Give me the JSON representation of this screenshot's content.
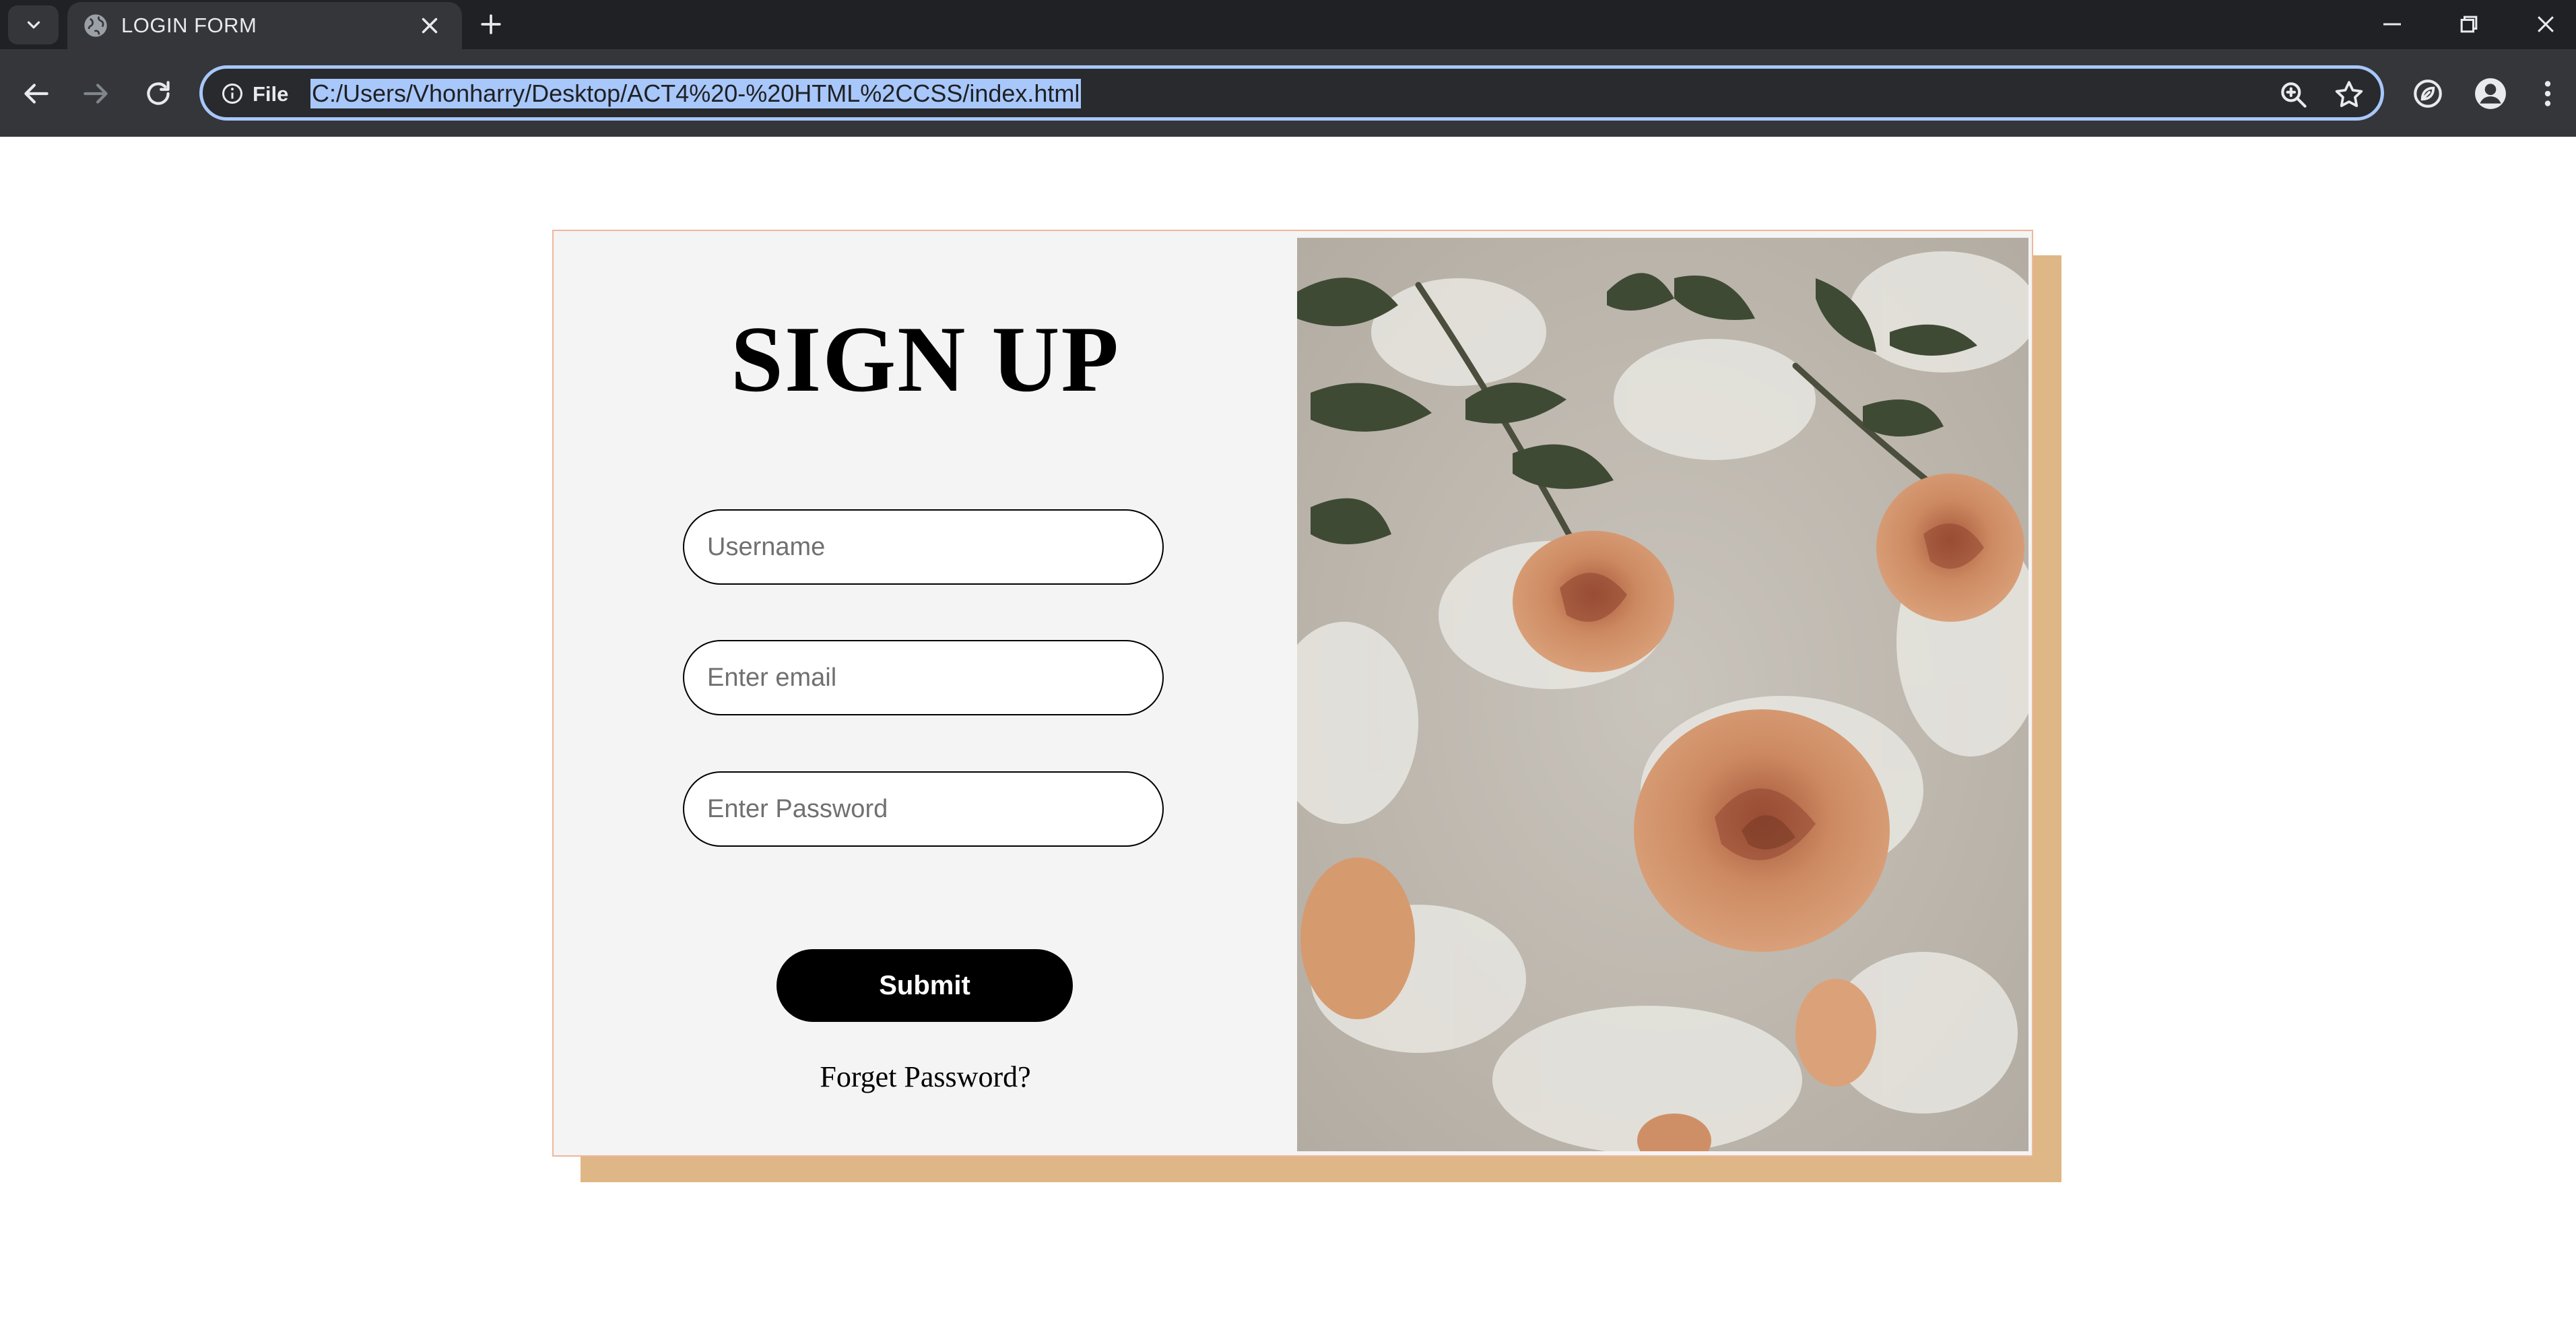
{
  "browser": {
    "tab_title": "LOGIN FORM",
    "site_label": "File",
    "url": "C:/Users/Vhonharry/Desktop/ACT4%20-%20HTML%2CCSS/index.html"
  },
  "form": {
    "title": "SIGN UP",
    "username_placeholder": "Username",
    "email_placeholder": "Enter email",
    "password_placeholder": "Enter Password",
    "submit_label": "Submit",
    "forgot_label": "Forget Password?"
  },
  "colors": {
    "card_background": "#f4f4f4",
    "card_border": "#f0b69b",
    "shadow": "#dfb786",
    "button": "#000000",
    "omnibox_focus": "#a8c7fa"
  },
  "icons": {
    "tab_menu": "chevron-down-icon",
    "tab_favicon": "globe-icon",
    "tab_close": "close-icon",
    "new_tab": "plus-icon",
    "back": "back-arrow-icon",
    "forward": "forward-arrow-icon",
    "reload": "reload-icon",
    "site_info": "info-icon",
    "zoom": "zoom-icon",
    "bookmark": "star-icon",
    "extension": "performance-leaf-icon",
    "profile": "profile-icon",
    "menu": "kebab-menu-icon",
    "minimize": "minimize-icon",
    "restore": "restore-icon",
    "close_window": "close-window-icon"
  },
  "image": {
    "description": "roses-in-bath-foam-photo"
  }
}
